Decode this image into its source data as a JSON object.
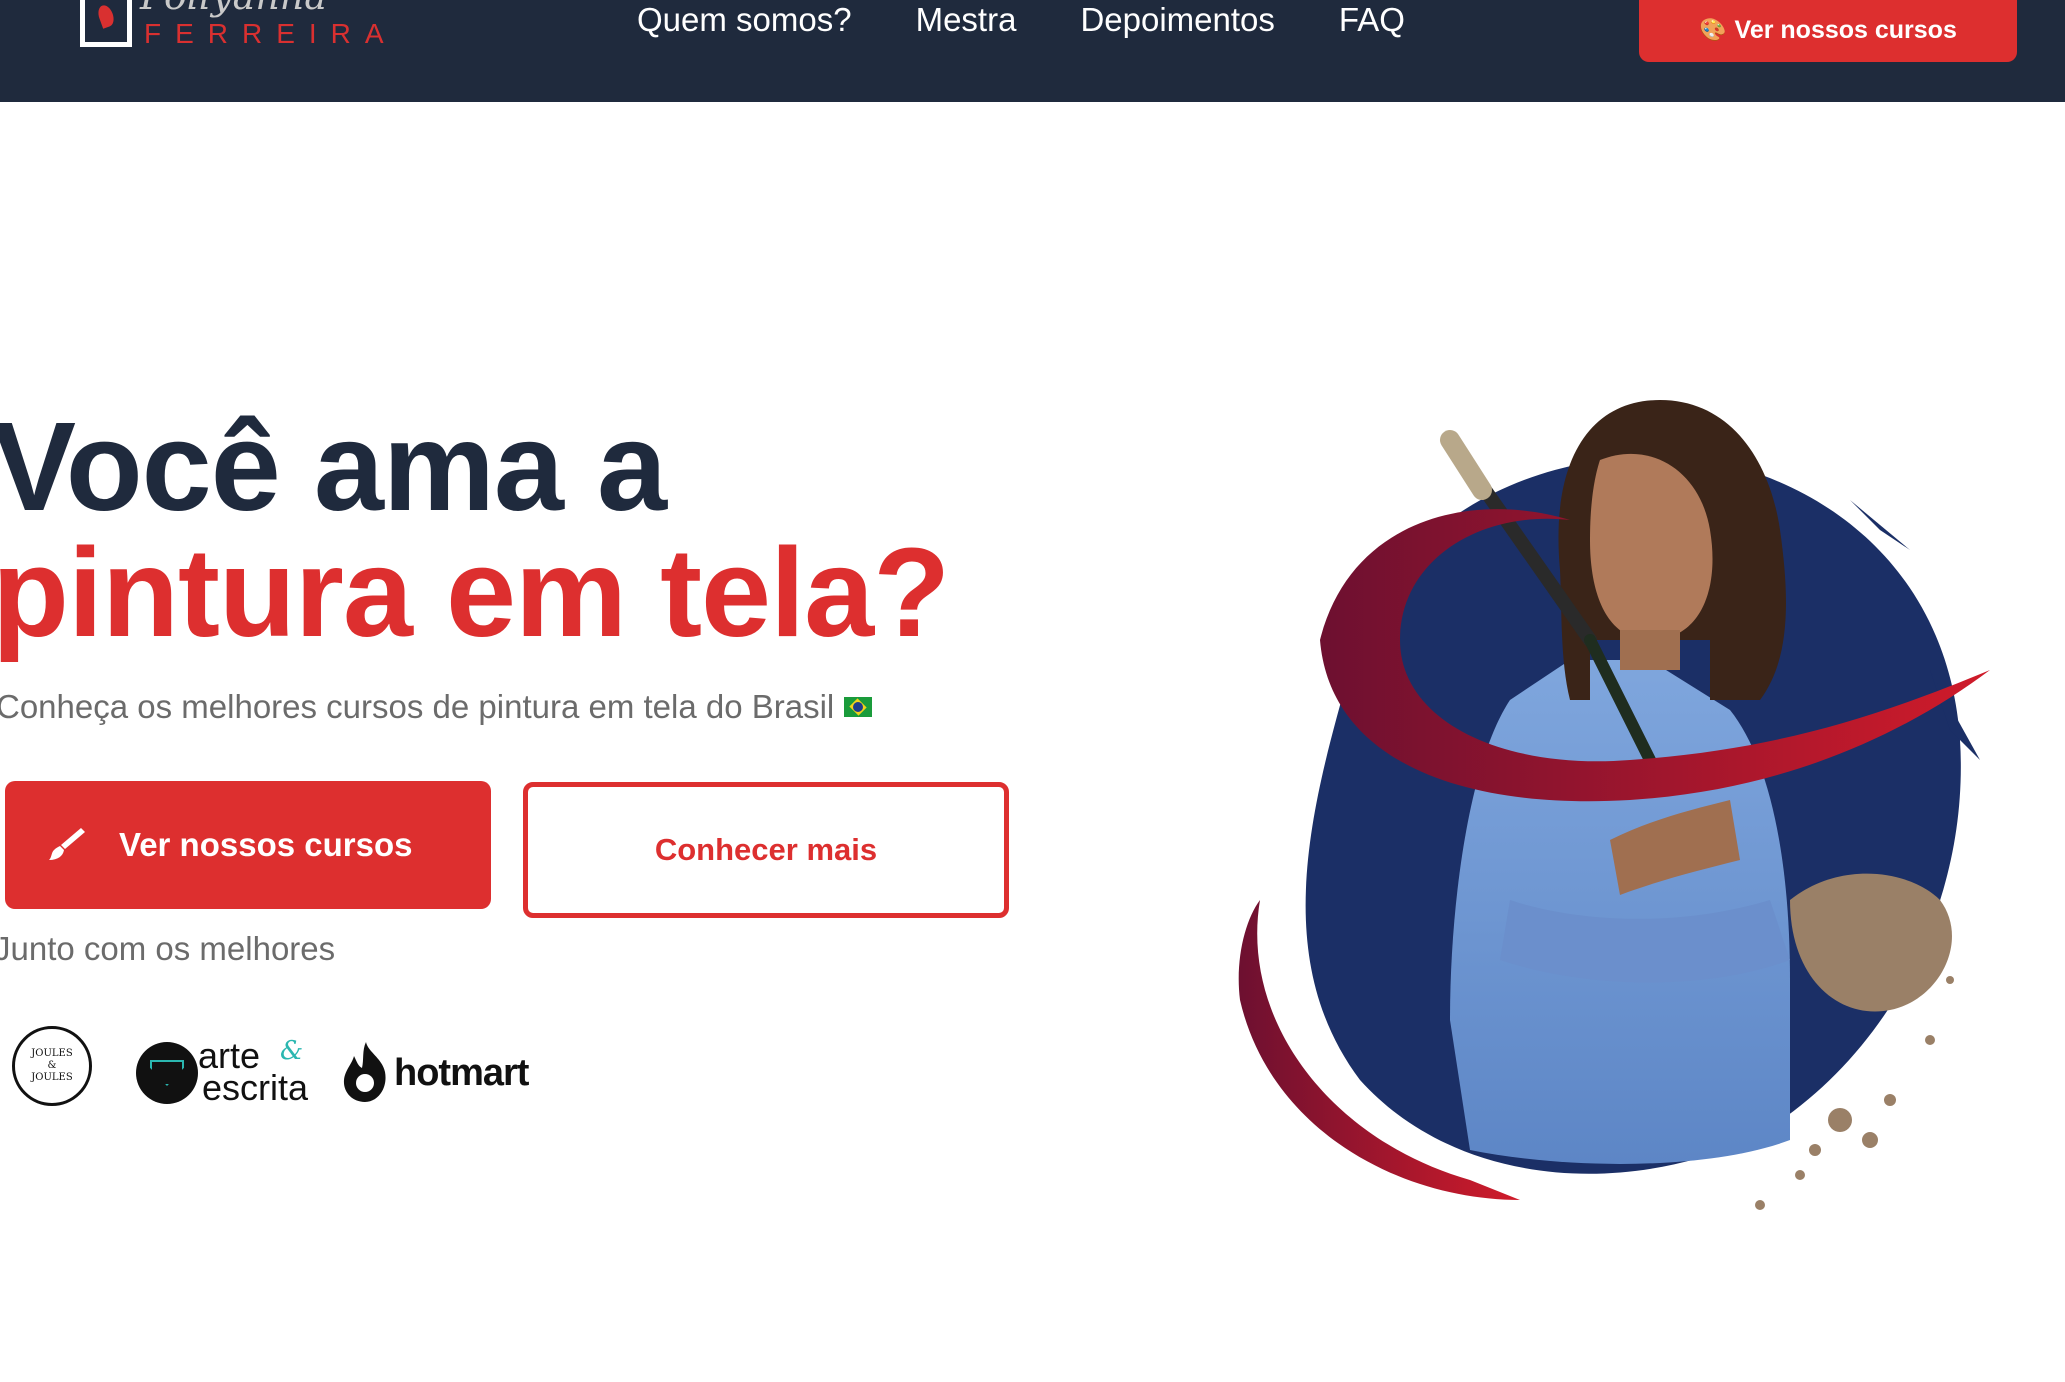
{
  "header": {
    "logo_script": "Pollyanna",
    "logo_caps": "FERREIRA",
    "nav": [
      "Quem somos?",
      "Mestra",
      "Depoimentos",
      "FAQ"
    ],
    "cta_icon": "palette-icon",
    "cta_label": "Ver nossos cursos"
  },
  "hero": {
    "headline_line1": "Você ama a",
    "headline_line2": "pintura em tela?",
    "subtitle": "Conheça os melhores cursos de pintura em tela do Brasil",
    "primary_button_label": "Ver nossos cursos",
    "primary_button_icon": "paintbrush-icon",
    "secondary_button_label": "Conhecer mais",
    "partners_title": "Junto com os melhores",
    "partners": {
      "joules_top": "JOULES",
      "joules_mid": "&",
      "joules_bottom": "JOULES",
      "arte_line1": "arte",
      "arte_amp": "&",
      "arte_line2": "escrita",
      "hotmart": "hotmart"
    }
  },
  "colors": {
    "navy": "#1f2a3d",
    "red": "#dd2f2f",
    "muted_text": "#6b6b6b",
    "splash_navy": "#1b2f66",
    "splash_red": "#a3122b",
    "paint_brown": "#9a8067"
  }
}
